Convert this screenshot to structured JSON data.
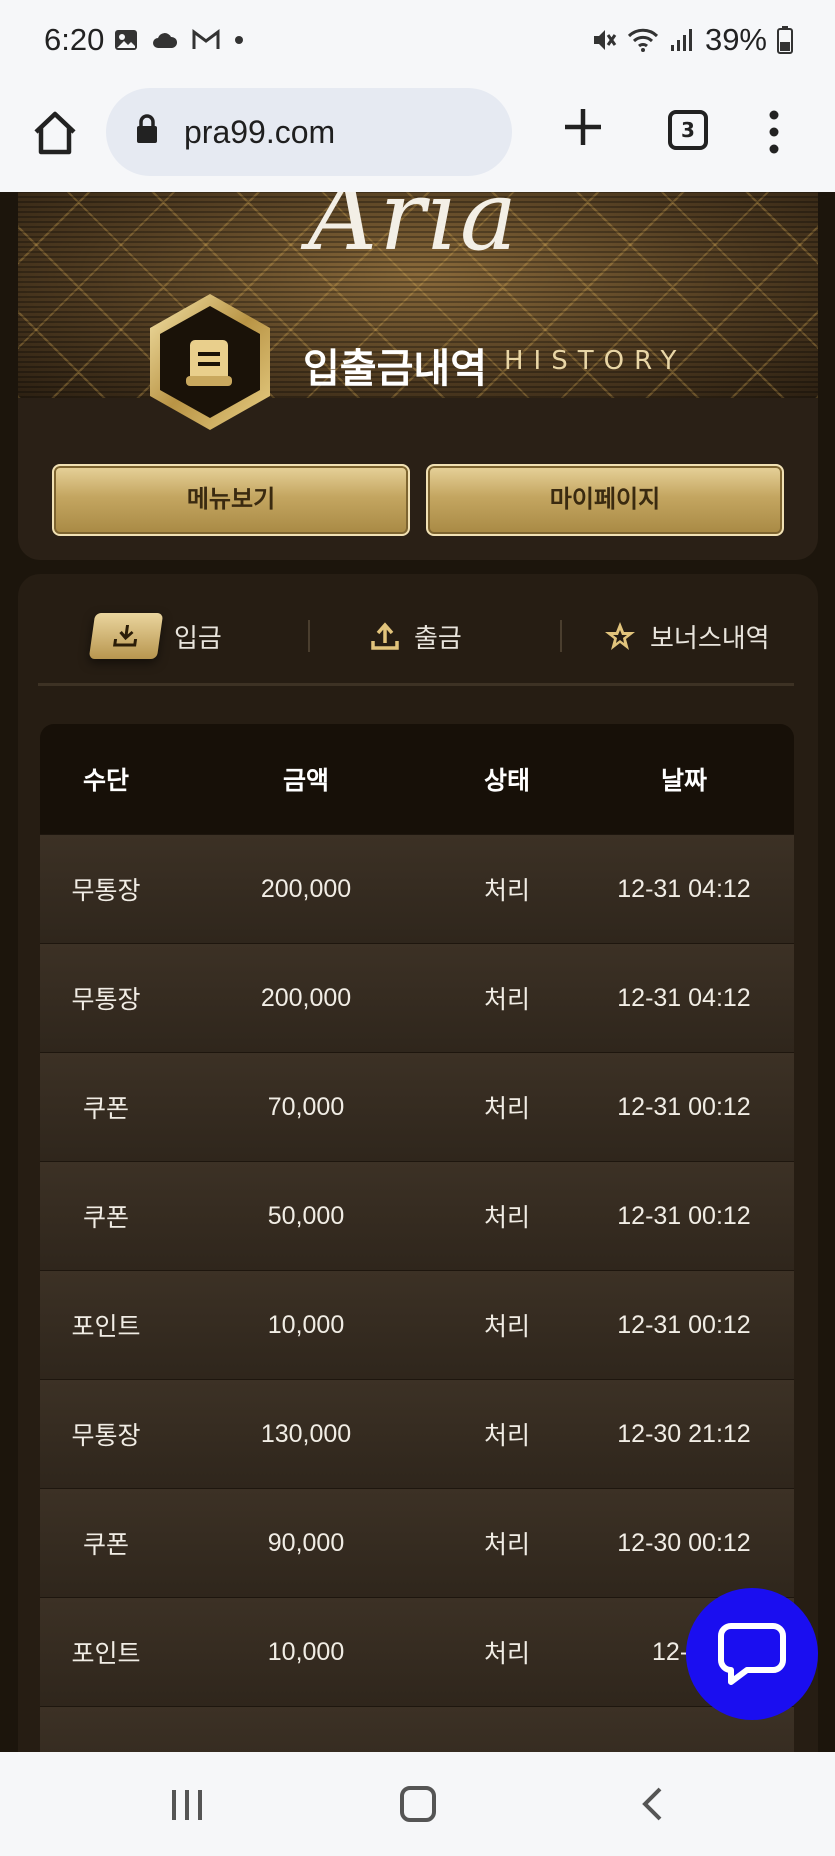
{
  "status_bar": {
    "time": "6:20",
    "battery": "39%",
    "left_icons": [
      "image-icon",
      "cloud-icon",
      "gmail-icon",
      "dot-icon"
    ],
    "right_icons": [
      "mute-icon",
      "wifi-icon",
      "signal-icon",
      "battery-icon"
    ]
  },
  "browser": {
    "url": "pra99.com",
    "tab_count": "3"
  },
  "hero": {
    "logo": "Aria",
    "title": "입출금내역",
    "subtitle": "HISTORY",
    "menu_button": "메뉴보기",
    "mypage_button": "마이페이지"
  },
  "tabs": {
    "deposit": "입금",
    "withdraw": "출금",
    "bonus": "보너스내역",
    "active": "deposit"
  },
  "table": {
    "headers": [
      "수단",
      "금액",
      "상태",
      "날짜"
    ],
    "rows": [
      {
        "method": "무통장",
        "amount": "200,000",
        "status": "처리",
        "date": "12-31 04:12"
      },
      {
        "method": "무통장",
        "amount": "200,000",
        "status": "처리",
        "date": "12-31 04:12"
      },
      {
        "method": "쿠폰",
        "amount": "70,000",
        "status": "처리",
        "date": "12-31 00:12"
      },
      {
        "method": "쿠폰",
        "amount": "50,000",
        "status": "처리",
        "date": "12-31 00:12"
      },
      {
        "method": "포인트",
        "amount": "10,000",
        "status": "처리",
        "date": "12-31 00:12"
      },
      {
        "method": "무통장",
        "amount": "130,000",
        "status": "처리",
        "date": "12-30 21:12"
      },
      {
        "method": "쿠폰",
        "amount": "90,000",
        "status": "처리",
        "date": "12-30 00:12"
      },
      {
        "method": "포인트",
        "amount": "10,000",
        "status": "처리",
        "date": "12-29"
      }
    ]
  },
  "colors": {
    "gold": "#c4a661",
    "page_bg": "#1c150c",
    "chat_button": "#1a0ef0"
  }
}
